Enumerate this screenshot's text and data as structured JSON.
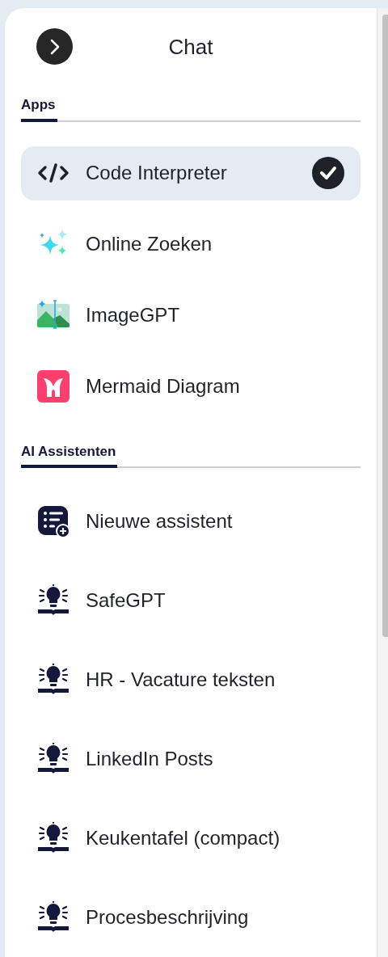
{
  "header": {
    "title": "Chat"
  },
  "sections": [
    {
      "title": "Apps",
      "items": [
        {
          "label": "Code Interpreter",
          "kind": "code",
          "selected": true
        },
        {
          "label": "Online Zoeken",
          "kind": "sparkles",
          "selected": false
        },
        {
          "label": "ImageGPT",
          "kind": "image",
          "selected": false
        },
        {
          "label": "Mermaid Diagram",
          "kind": "mermaid",
          "selected": false
        }
      ]
    },
    {
      "title": "AI Assistenten",
      "items": [
        {
          "label": "Nieuwe assistent",
          "kind": "new-assistant",
          "selected": false
        },
        {
          "label": "SafeGPT",
          "kind": "bulb",
          "selected": false
        },
        {
          "label": "HR - Vacature teksten",
          "kind": "bulb",
          "selected": false
        },
        {
          "label": "LinkedIn Posts",
          "kind": "bulb",
          "selected": false
        },
        {
          "label": "Keukentafel (compact)",
          "kind": "bulb",
          "selected": false
        },
        {
          "label": "Procesbeschrijving",
          "kind": "bulb",
          "selected": false
        }
      ]
    }
  ]
}
